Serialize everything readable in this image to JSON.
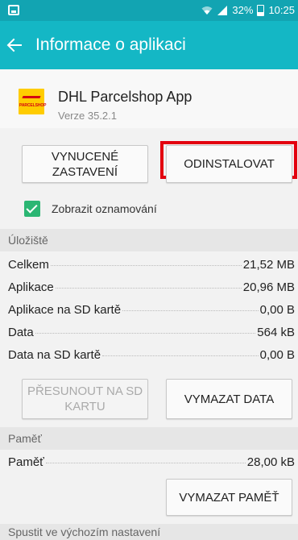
{
  "status_bar": {
    "battery": "32%",
    "time": "10:25"
  },
  "app_bar": {
    "title": "Informace o aplikaci"
  },
  "app": {
    "name": "DHL Parcelshop App",
    "version": "Verze 35.2.1",
    "icon_tag": "PARCELSHOP"
  },
  "buttons": {
    "force_stop": "VYNUCENÉ\nZASTAVENÍ",
    "uninstall": "ODINSTALOVAT",
    "move_to_sd": "PŘESUNOUT NA SD\nKARTU",
    "clear_data": "VYMAZAT DATA",
    "clear_cache": "VYMAZAT PAMĚŤ"
  },
  "notifications": {
    "label": "Zobrazit oznamování",
    "checked": true
  },
  "storage": {
    "title": "Úložiště",
    "rows": [
      {
        "label": "Celkem",
        "value": "21,52 MB"
      },
      {
        "label": "Aplikace",
        "value": "20,96 MB"
      },
      {
        "label": "Aplikace na SD kartě",
        "value": "0,00 B"
      },
      {
        "label": "Data",
        "value": "564 kB"
      },
      {
        "label": "Data na SD kartě",
        "value": "0,00 B"
      }
    ]
  },
  "memory": {
    "title": "Paměť",
    "rows": [
      {
        "label": "Paměť",
        "value": "28,00 kB"
      }
    ]
  },
  "defaults": {
    "title": "Spustit ve výchozím nastavení"
  },
  "colors": {
    "status_bar": "#12a4b2",
    "app_bar": "#14b7c5",
    "highlight": "#e3000f",
    "checkbox": "#2bb673"
  },
  "icons": [
    "gallery-icon",
    "wifi-icon",
    "signal-icon",
    "battery-icon",
    "back-arrow-icon"
  ]
}
